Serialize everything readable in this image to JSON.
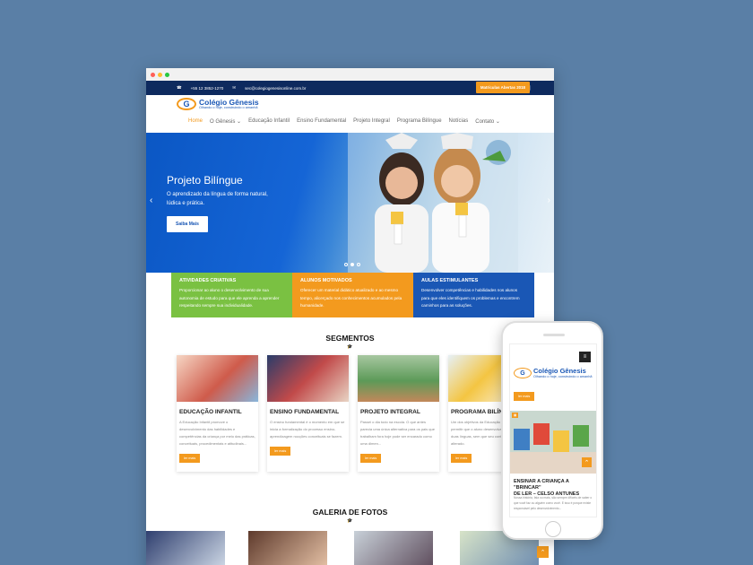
{
  "topbar": {
    "phone": "+55 12 3852-1270",
    "email": "sec@colegiogenesisonline.com.br",
    "cta": "Matrículas Abertas 2018"
  },
  "logo": {
    "name": "Colégio Gênesis",
    "tagline": "Olhando o hoje, construindo o amanhã"
  },
  "nav": [
    "Home",
    "O Gênesis ⌄",
    "Educação Infantil",
    "Ensino Fundamental",
    "Projeto Integral",
    "Programa Bilíngue",
    "Notícias",
    "Contato ⌄"
  ],
  "hero": {
    "title": "Projeto Bilíngue",
    "text_line1": "O aprendizado da língua de forma natural,",
    "text_line2": "lúdica e prática.",
    "button": "Saiba Mais"
  },
  "features": [
    {
      "title": "ATIVIDADES CRIATIVAS",
      "text": "Proporcionar ao aluno o desenvolvimento de sua autonomia de estudo para que ele aprenda a aprender respeitando sempre sua individualidade.",
      "color": "#7ac142"
    },
    {
      "title": "ALUNOS MOTIVADOS",
      "text": "Oferecer um material didático atualizado e ao mesmo tempo, alicerçado nos conhecimentos acumulados pela humanidade.",
      "color": "#f39a1e"
    },
    {
      "title": "AULAS ESTIMULANTES",
      "text": "Desenvolver competências e habilidades nos alunos para que eles identifiquem os problemas e encontrem caminhos para as soluções.",
      "color": "#1a57b5"
    }
  ],
  "segments": {
    "title": "SEGMENTOS",
    "cards": [
      {
        "title": "EDUCAÇÃO INFANTIL",
        "text": "A Educação Infantil promove o desenvolvimento das habilidades e competências da criança por meio das práticas, conceituais, procedimentais e atitudinais...",
        "more": "ler mais"
      },
      {
        "title": "ENSINO FUNDAMENTAL",
        "text": "O ensino fundamental é o momento em que se inicia a formalização do processo ensino-aprendizagem nocções conceituais se fazem.",
        "more": "ler mais"
      },
      {
        "title": "PROJETO INTEGRAL",
        "text": "Passei o dia todo na escola. O que antes parecia uma única alternativa para os pais que trabalham fora hoje pode ser encarado como uma dimen...",
        "more": "ler mais"
      },
      {
        "title": "PROGRAMA BILÍNGUE",
        "text": "Um dos objetivos da Educação Bilíngue é permitir que o aluno desenvolva fluência nas duas línguas, sem que seu contexto social seja alterado.",
        "more": "ler mais"
      }
    ]
  },
  "gallery": {
    "title": "GALERIA DE FOTOS"
  },
  "phone": {
    "logo_name": "Colégio Gênesis",
    "logo_tagline": "Olhando o hoje, construindo o amanhã",
    "more": "ler mais",
    "post_title_line1": "ENSINAR A CRIANÇA A \"BRINCAR\"",
    "post_title_line2": "DE LER – CELSO ANTUNES",
    "post_text": "Nossa história, fala ou mais, são sempre difíceis de saber o que você faz ou alguém como você. E isso é porque existe responsável pelo desenvolvimento...",
    "menu_icon": "hamburger-icon"
  }
}
